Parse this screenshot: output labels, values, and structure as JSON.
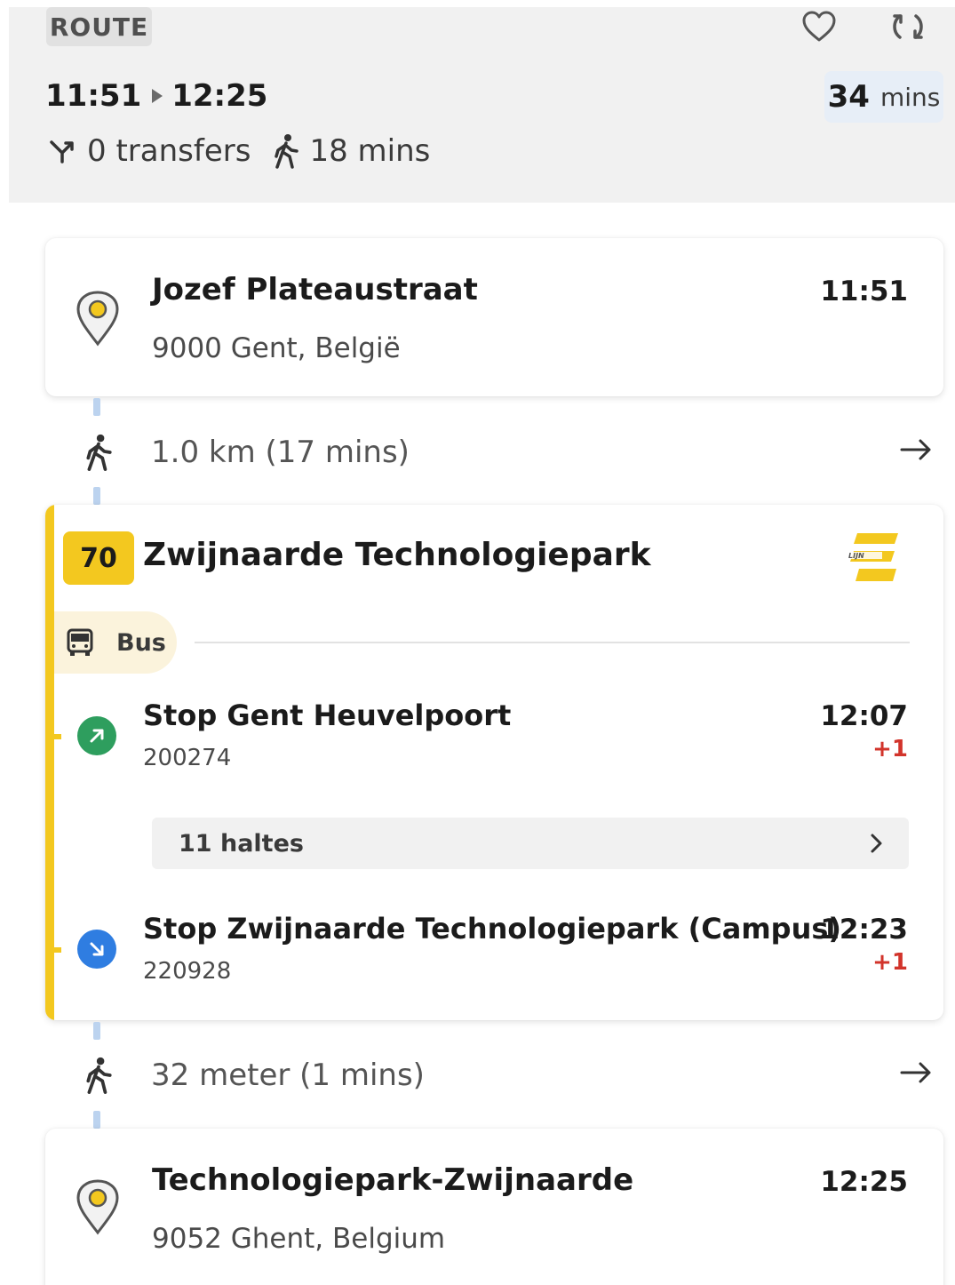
{
  "header": {
    "route_label": "ROUTE",
    "depart_time": "11:51",
    "arrive_time": "12:25",
    "duration_value": "34",
    "duration_unit": "mins",
    "transfers": "0 transfers",
    "walk_total": "18 mins",
    "icons": [
      "heart-icon",
      "refresh-icon",
      "transfer-icon",
      "walk-icon"
    ]
  },
  "origin": {
    "name": "Jozef Plateaustraat",
    "address": "9000 Gent, België",
    "time": "11:51"
  },
  "walk1": {
    "text": "1.0 km (17 mins)"
  },
  "leg": {
    "line_number": "70",
    "destination": "Zwijnaarde Technologiepark",
    "mode": "Bus",
    "operator_logo": "de-lijn-logo",
    "board": {
      "name": "Stop Gent Heuvelpoort",
      "code": "200274",
      "time": "12:07",
      "delay": "+1"
    },
    "stops_button": "11 haltes",
    "alight": {
      "name": "Stop Zwijnaarde Technologiepark (Campus)",
      "code": "220928",
      "time": "12:23",
      "delay": "+1"
    }
  },
  "walk2": {
    "text": "32 meter (1 mins)"
  },
  "destination": {
    "name": "Technologiepark-Zwijnaarde",
    "address": "9052 Ghent, Belgium",
    "time": "12:25"
  },
  "colors": {
    "accent_yellow": "#f3c81f",
    "board_green": "#2e9e5e",
    "alight_blue": "#2f7de1",
    "delay_red": "#d2342b",
    "walk_dash": "#bcd3ef"
  }
}
